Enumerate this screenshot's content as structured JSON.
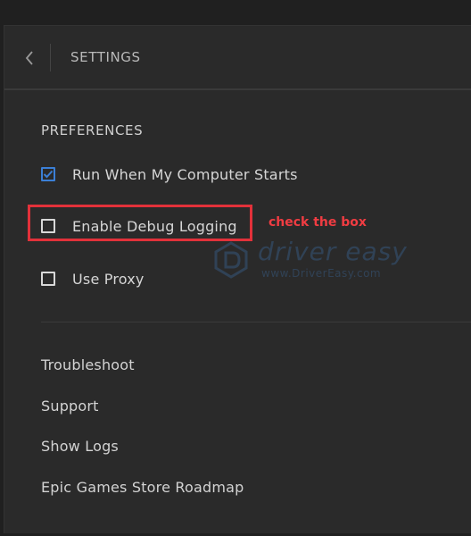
{
  "header": {
    "title": "SETTINGS",
    "back_icon": "chevron-left-icon"
  },
  "preferences": {
    "title": "PREFERENCES",
    "options": [
      {
        "label": "Run When My Computer Starts",
        "checked": true
      },
      {
        "label": "Enable Debug Logging",
        "checked": false
      },
      {
        "label": "Use Proxy",
        "checked": false
      }
    ]
  },
  "annotation": {
    "text": "check the box",
    "color": "#e2313a"
  },
  "watermark": {
    "brand": "driver easy",
    "url": "www.DriverEasy.com"
  },
  "links": [
    "Troubleshoot",
    "Support",
    "Show Logs",
    "Epic Games Store Roadmap"
  ],
  "colors": {
    "accent": "#3b7fd6",
    "background": "#2a2a2a",
    "highlight": "#e2313a"
  }
}
